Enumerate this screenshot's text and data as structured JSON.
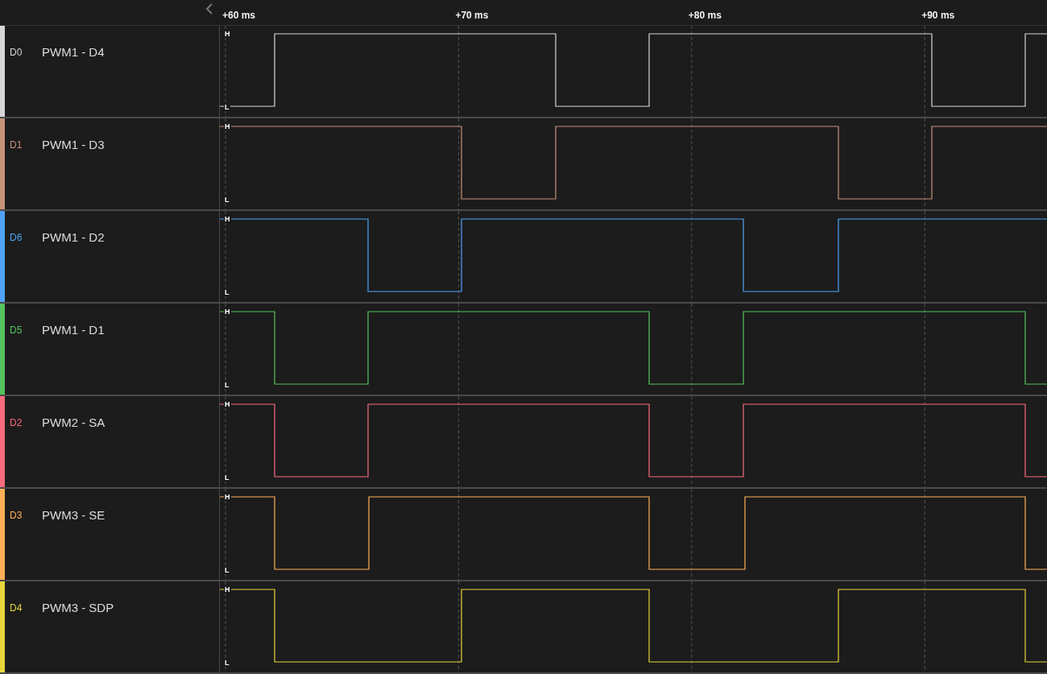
{
  "timeline": {
    "ticks": [
      "+60 ms",
      "+70 ms",
      "+80 ms",
      "+90 ms"
    ]
  },
  "channels": [
    {
      "id": "D0",
      "name": "PWM1 - D4",
      "color": "#d6d6d6",
      "high": "H",
      "low": "L"
    },
    {
      "id": "D1",
      "name": "PWM1 - D3",
      "color": "#c8917a",
      "high": "H",
      "low": "L"
    },
    {
      "id": "D6",
      "name": "PWM1 - D2",
      "color": "#4ea3f7",
      "high": "H",
      "low": "L"
    },
    {
      "id": "D5",
      "name": "PWM1 - D1",
      "color": "#55c35e",
      "high": "H",
      "low": "L"
    },
    {
      "id": "D2",
      "name": "PWM2 - SA",
      "color": "#fb6b7b",
      "high": "H",
      "low": "L"
    },
    {
      "id": "D3",
      "name": "PWM3 - SE",
      "color": "#ffb056",
      "high": "H",
      "low": "L"
    },
    {
      "id": "D4",
      "name": "PWM3 - SDP",
      "color": "#e6d63a",
      "high": "H",
      "low": "L"
    }
  ]
}
